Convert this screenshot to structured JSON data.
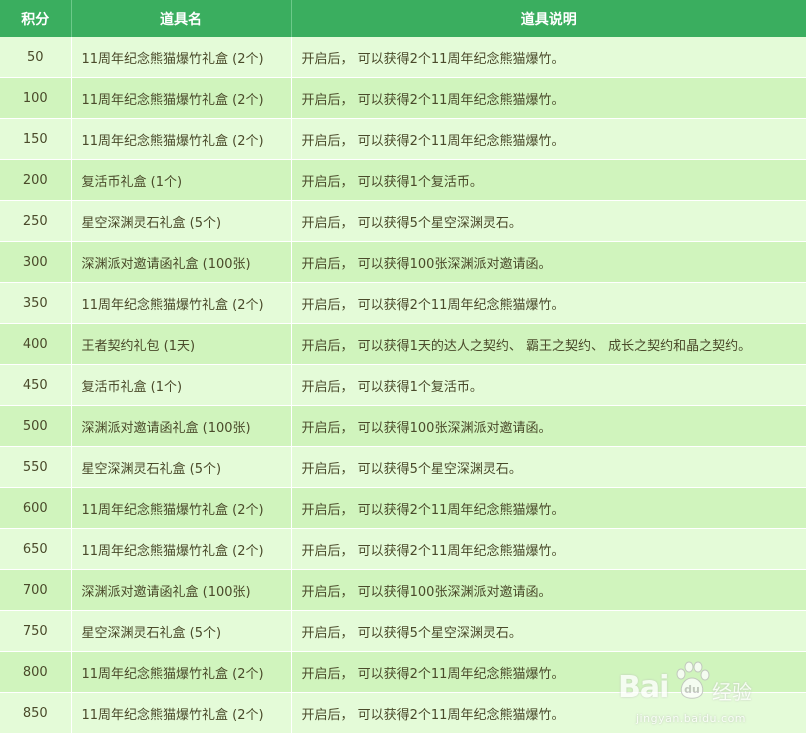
{
  "table": {
    "headers": [
      "积分",
      "道具名",
      "道具说明"
    ],
    "rows": [
      {
        "score": "50",
        "item": "11周年纪念熊猫爆竹礼盒 (2个)",
        "desc": "开启后， 可以获得2个11周年纪念熊猫爆竹。"
      },
      {
        "score": "100",
        "item": "11周年纪念熊猫爆竹礼盒 (2个)",
        "desc": "开启后， 可以获得2个11周年纪念熊猫爆竹。"
      },
      {
        "score": "150",
        "item": "11周年纪念熊猫爆竹礼盒 (2个)",
        "desc": "开启后， 可以获得2个11周年纪念熊猫爆竹。"
      },
      {
        "score": "200",
        "item": "复活币礼盒 (1个)",
        "desc": "开启后， 可以获得1个复活币。"
      },
      {
        "score": "250",
        "item": "星空深渊灵石礼盒 (5个)",
        "desc": "开启后， 可以获得5个星空深渊灵石。"
      },
      {
        "score": "300",
        "item": "深渊派对邀请函礼盒 (100张)",
        "desc": "开启后， 可以获得100张深渊派对邀请函。"
      },
      {
        "score": "350",
        "item": "11周年纪念熊猫爆竹礼盒 (2个)",
        "desc": "开启后， 可以获得2个11周年纪念熊猫爆竹。"
      },
      {
        "score": "400",
        "item": "王者契约礼包 (1天)",
        "desc": "开启后， 可以获得1天的达人之契约、 霸王之契约、 成长之契约和晶之契约。"
      },
      {
        "score": "450",
        "item": "复活币礼盒 (1个)",
        "desc": "开启后， 可以获得1个复活币。"
      },
      {
        "score": "500",
        "item": "深渊派对邀请函礼盒 (100张)",
        "desc": "开启后， 可以获得100张深渊派对邀请函。"
      },
      {
        "score": "550",
        "item": "星空深渊灵石礼盒 (5个)",
        "desc": "开启后， 可以获得5个星空深渊灵石。"
      },
      {
        "score": "600",
        "item": "11周年纪念熊猫爆竹礼盒 (2个)",
        "desc": "开启后， 可以获得2个11周年纪念熊猫爆竹。"
      },
      {
        "score": "650",
        "item": "11周年纪念熊猫爆竹礼盒 (2个)",
        "desc": "开启后， 可以获得2个11周年纪念熊猫爆竹。"
      },
      {
        "score": "700",
        "item": "深渊派对邀请函礼盒 (100张)",
        "desc": "开启后， 可以获得100张深渊派对邀请函。"
      },
      {
        "score": "750",
        "item": "星空深渊灵石礼盒 (5个)",
        "desc": "开启后， 可以获得5个星空深渊灵石。"
      },
      {
        "score": "800",
        "item": "11周年纪念熊猫爆竹礼盒 (2个)",
        "desc": "开启后， 可以获得2个11周年纪念熊猫爆竹。"
      },
      {
        "score": "850",
        "item": "11周年纪念熊猫爆竹礼盒 (2个)",
        "desc": "开启后， 可以获得2个11周年纪念熊猫爆竹。"
      }
    ]
  },
  "watermark": {
    "logo_left": "Bai",
    "logo_right": "经验",
    "url": "jingyan.baidu.com",
    "icon": "baidu-paw-icon"
  },
  "colors": {
    "header_bg": "#3aae5f",
    "row_light": "#e4fbd8",
    "row_dark": "#d0f4bd",
    "text": "#4a4a2a"
  }
}
